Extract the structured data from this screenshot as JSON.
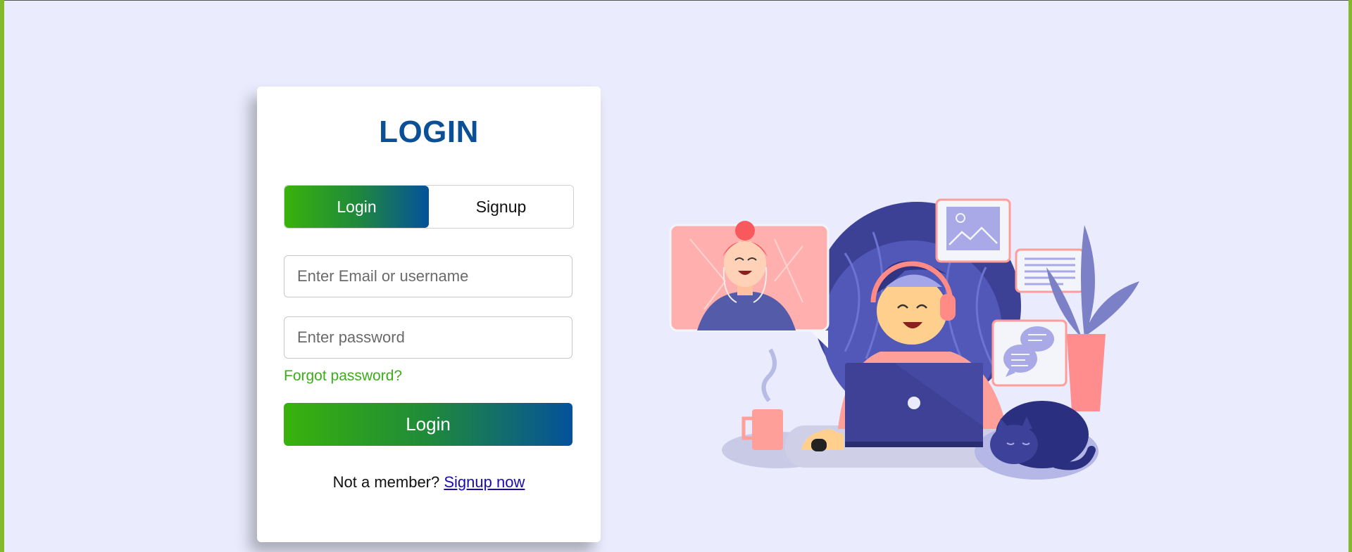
{
  "login": {
    "title": "LOGIN",
    "tabs": [
      "Login",
      "Signup"
    ],
    "email_placeholder": "Enter Email or username",
    "password_placeholder": "Enter password",
    "forgot_password": "Forgot password?",
    "submit_label": "Login",
    "member_prompt": "Not a member?",
    "signup_link": "Signup now"
  },
  "colors": {
    "background": "#eaebfd",
    "accent_green": "#39b20b",
    "accent_blue": "#05519b",
    "title": "#0b4f96",
    "link": "#1a0dab"
  },
  "icons": [
    "image-icon",
    "document-icon",
    "chat-icon"
  ]
}
